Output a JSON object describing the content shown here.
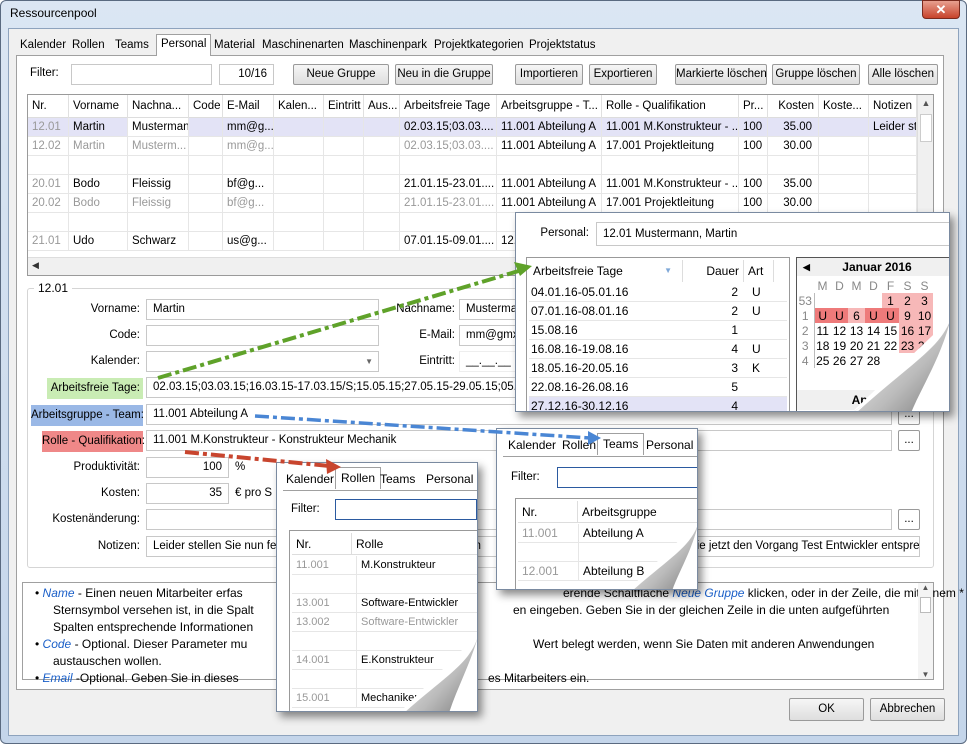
{
  "window": {
    "title": "Ressourcenpool",
    "close_icon": "close-icon"
  },
  "tabs": [
    "Kalender",
    "Rollen",
    "Teams",
    "Personal",
    "Material",
    "Maschinenarten",
    "Maschinenpark",
    "Projektkategorien",
    "Projektstatus"
  ],
  "active_tab": "Personal",
  "toolbar": {
    "filter_label": "Filter:",
    "filter_value": "",
    "counter": "10/16",
    "neue_gruppe": "Neue Gruppe",
    "neu_in_gruppe": "Neu in die Gruppe",
    "importieren": "Importieren",
    "exportieren": "Exportieren",
    "markierte_loeschen": "Markierte löschen",
    "gruppe_loeschen": "Gruppe löschen",
    "alle_loeschen": "Alle löschen"
  },
  "grid": {
    "columns": [
      "Nr.",
      "Vorname",
      "Nachna...",
      "Code",
      "E-Mail",
      "Kalen...",
      "Eintritt",
      "Aus...",
      "Arbeitsfreie Tage",
      "Arbeitsgruppe - T...",
      "Rolle - Qualifikation",
      "Pr...",
      "Kosten",
      "Koste...",
      "Notizen"
    ],
    "rows": [
      {
        "cells": [
          "12.01",
          "Martin",
          "Mustermann",
          "",
          "mm@g...",
          "",
          "",
          "",
          "02.03.15;03.03....",
          "11.001 Abteilung A",
          "11.001 M.Konstrukteur - ...",
          "100",
          "35.00",
          "",
          "Leider ste"
        ],
        "selected": true,
        "muted": false
      },
      {
        "cells": [
          "12.02",
          "Martin",
          "Musterm...",
          "",
          "mm@g...",
          "",
          "",
          "",
          "02.03.15;03.03....",
          "11.001 Abteilung A",
          "17.001 Projektleitung",
          "100",
          "30.00",
          "",
          ""
        ],
        "selected": false,
        "muted": true
      },
      {
        "cells": [
          "",
          "",
          "",
          "",
          "",
          "",
          "",
          "",
          "",
          "",
          "",
          "",
          "",
          "",
          ""
        ],
        "selected": false,
        "muted": false
      },
      {
        "cells": [
          "20.01",
          "Bodo",
          "Fleissig",
          "",
          "bf@g...",
          "",
          "",
          "",
          "21.01.15-23.01....",
          "11.001 Abteilung A",
          "11.001 M.Konstrukteur - ...",
          "100",
          "35.00",
          "",
          ""
        ],
        "selected": false,
        "muted": false
      },
      {
        "cells": [
          "20.02",
          "Bodo",
          "Fleissig",
          "",
          "bf@g...",
          "",
          "",
          "",
          "21.01.15-23.01....",
          "11.001 Abteilung A",
          "17.001 Projektleitung",
          "100",
          "30.00",
          "",
          ""
        ],
        "selected": false,
        "muted": true
      },
      {
        "cells": [
          "",
          "",
          "",
          "",
          "",
          "",
          "",
          "",
          "",
          "",
          "",
          "",
          "",
          "",
          ""
        ],
        "selected": false,
        "muted": false
      },
      {
        "cells": [
          "21.01",
          "Udo",
          "Schwarz",
          "",
          "us@g...",
          "",
          "",
          "",
          "07.01.15-09.01....",
          "12.",
          "",
          "",
          "",
          "",
          ""
        ],
        "selected": false,
        "muted": false
      }
    ]
  },
  "detail": {
    "group_title": "12.01",
    "vorname_label": "Vorname:",
    "vorname": "Martin",
    "nachname_label": "Nachname:",
    "nachname": "Musterman",
    "code_label": "Code:",
    "code": "",
    "email_label": "E-Mail:",
    "email": "mm@gmx.",
    "kalender_label": "Kalender:",
    "kalender": "",
    "eintritt_label": "Eintritt:",
    "eintritt": "__.__.__",
    "arbeitsfreie_label": "Arbeitsfreie Tage:",
    "arbeitsfreie": "02.03.15;03.03.15;16.03.15-17.03.15/S;15.05.15;27.05.15-29.05.15;05.06.1",
    "arbeitsgruppe_label": "Arbeitsgruppe - Team:",
    "arbeitsgruppe": "11.001 Abteilung A",
    "rolle_label": "Rolle - Qualifikation:",
    "rolle": "11.001 M.Konstrukteur - Konstrukteur Mechanik",
    "produktivitaet_label": "Produktivität:",
    "produktivitaet": "100",
    "percent": "%",
    "kosten_label": "Kosten:",
    "kosten": "35",
    "kosten_unit": "€ pro S",
    "kostenaenderung_label": "Kostenänderung:",
    "kostenaenderung": "",
    "notizen_label": "Notizen:",
    "notizen_left": "Leider stellen Sie nun fe",
    "notizen_mid": "em",
    "notizen_right": "Sie jetzt den Vorgang Test Entwickler entsprecl",
    "ellipsis": "...",
    "label_colors": {
      "arbeitsfreie": "#c9ecb4",
      "arbeitsgruppe": "#9ab8e6",
      "rolle": "#ef8888"
    }
  },
  "help": {
    "lines": [
      {
        "kw": "Name",
        "left": " - Einen neuen Mitarbeiter erfas",
        "right_pre": "erende Schaltfläche ",
        "right_kw": "Neue Gruppe",
        "right": " klicken, oder in der Zeile, die mit einem *"
      },
      {
        "kw": "",
        "left": "Sternsymbol versehen ist, in die Spalt",
        "right_pre": "",
        "right_kw": "",
        "right": "en eingeben. Geben Sie in der gleichen Zeile in die unten aufgeführten"
      },
      {
        "kw": "",
        "left": "Spalten entsprechende Informationen",
        "right_pre": "",
        "right_kw": "",
        "right": ""
      },
      {
        "kw": "Code",
        "left": " - Optional. Dieser Parameter mu",
        "right_pre": "",
        "right_kw": "",
        "right": "Wert belegt werden, wenn Sie Daten mit anderen Anwendungen"
      },
      {
        "kw": "",
        "left": "austauschen wollen.",
        "right_pre": "",
        "right_kw": "",
        "right": ""
      },
      {
        "kw": "Email",
        "left": " -Optional. Geben Sie in dieses",
        "right_pre": "",
        "right_kw": "",
        "right": "es Mitarbeiters ein."
      }
    ]
  },
  "footer": {
    "ok": "OK",
    "abbrechen": "Abbrechen"
  },
  "popup_personal": {
    "label": "Personal:",
    "value": "12.01 Mustermann, Martin",
    "columns": [
      "Arbeitsfreie Tage",
      "Dauer",
      "Art"
    ],
    "rows": [
      [
        "04.01.16-05.01.16",
        "2",
        "U"
      ],
      [
        "07.01.16-08.01.16",
        "2",
        "U"
      ],
      [
        "15.08.16",
        "1",
        ""
      ],
      [
        "16.08.16-19.08.16",
        "4",
        "U"
      ],
      [
        "18.05.16-20.05.16",
        "3",
        "K"
      ],
      [
        "22.08.16-26.08.16",
        "5",
        ""
      ],
      [
        "27.12.16-30.12.16",
        "4",
        ""
      ]
    ],
    "calendar": {
      "month": "Januar 2016",
      "next_month": "April 201",
      "weekdays": [
        "M",
        "D",
        "M",
        "D",
        "F",
        "S",
        "S"
      ],
      "weeks": [
        {
          "nr": "53",
          "days": [
            [
              "",
              ""
            ],
            [
              "",
              ""
            ],
            [
              "",
              ""
            ],
            [
              "",
              ""
            ],
            [
              "1",
              "we"
            ],
            [
              "2",
              "we"
            ],
            [
              "3",
              "we"
            ]
          ]
        },
        {
          "nr": "1",
          "days": [
            [
              "U",
              "off"
            ],
            [
              "U",
              "off"
            ],
            [
              "6",
              "we"
            ],
            [
              "U",
              "off"
            ],
            [
              "U",
              "off"
            ],
            [
              "9",
              "we"
            ],
            [
              "10",
              "we"
            ]
          ]
        },
        {
          "nr": "2",
          "days": [
            [
              "11",
              ""
            ],
            [
              "12",
              ""
            ],
            [
              "13",
              ""
            ],
            [
              "14",
              ""
            ],
            [
              "15",
              ""
            ],
            [
              "16",
              "we"
            ],
            [
              "17",
              "we"
            ]
          ]
        },
        {
          "nr": "3",
          "days": [
            [
              "18",
              ""
            ],
            [
              "19",
              ""
            ],
            [
              "20",
              ""
            ],
            [
              "21",
              ""
            ],
            [
              "22",
              ""
            ],
            [
              "23",
              "we"
            ],
            [
              "24",
              "we"
            ]
          ]
        },
        {
          "nr": "4",
          "days": [
            [
              "25",
              ""
            ],
            [
              "26",
              ""
            ],
            [
              "27",
              ""
            ],
            [
              "28",
              ""
            ],
            [
              "",
              ""
            ],
            [
              "",
              ""
            ],
            [
              "",
              ""
            ]
          ]
        }
      ],
      "colors": {
        "weekend": "#f7b8b8",
        "off": "#ee7a7a"
      }
    }
  },
  "popup_rollen": {
    "tabs": [
      "Kalender",
      "Rollen",
      "Teams",
      "Personal"
    ],
    "active": "Rollen",
    "filter_label": "Filter:",
    "columns": [
      "Nr.",
      "Rolle"
    ],
    "rows": [
      [
        "11.001",
        "M.Konstrukteur",
        false
      ],
      [
        "",
        "",
        false
      ],
      [
        "13.001",
        "Software-Entwickler",
        false
      ],
      [
        "13.002",
        "Software-Entwickler",
        true
      ],
      [
        "",
        "",
        false
      ],
      [
        "14.001",
        "E.Konstrukteur",
        false
      ],
      [
        "",
        "",
        false
      ],
      [
        "15.001",
        "Mechaniker",
        false
      ]
    ]
  },
  "popup_teams": {
    "tabs": [
      "Kalender",
      "Rollen",
      "Teams",
      "Personal"
    ],
    "active": "Teams",
    "filter_label": "Filter:",
    "columns": [
      "Nr.",
      "Arbeitsgruppe"
    ],
    "rows": [
      [
        "11.001",
        "Abteilung A"
      ],
      [
        "",
        ""
      ],
      [
        "12.001",
        "Abteilung B"
      ]
    ]
  },
  "arrow_colors": {
    "green": "#5fa22a",
    "blue": "#4a86d4",
    "red": "#c8452e"
  }
}
